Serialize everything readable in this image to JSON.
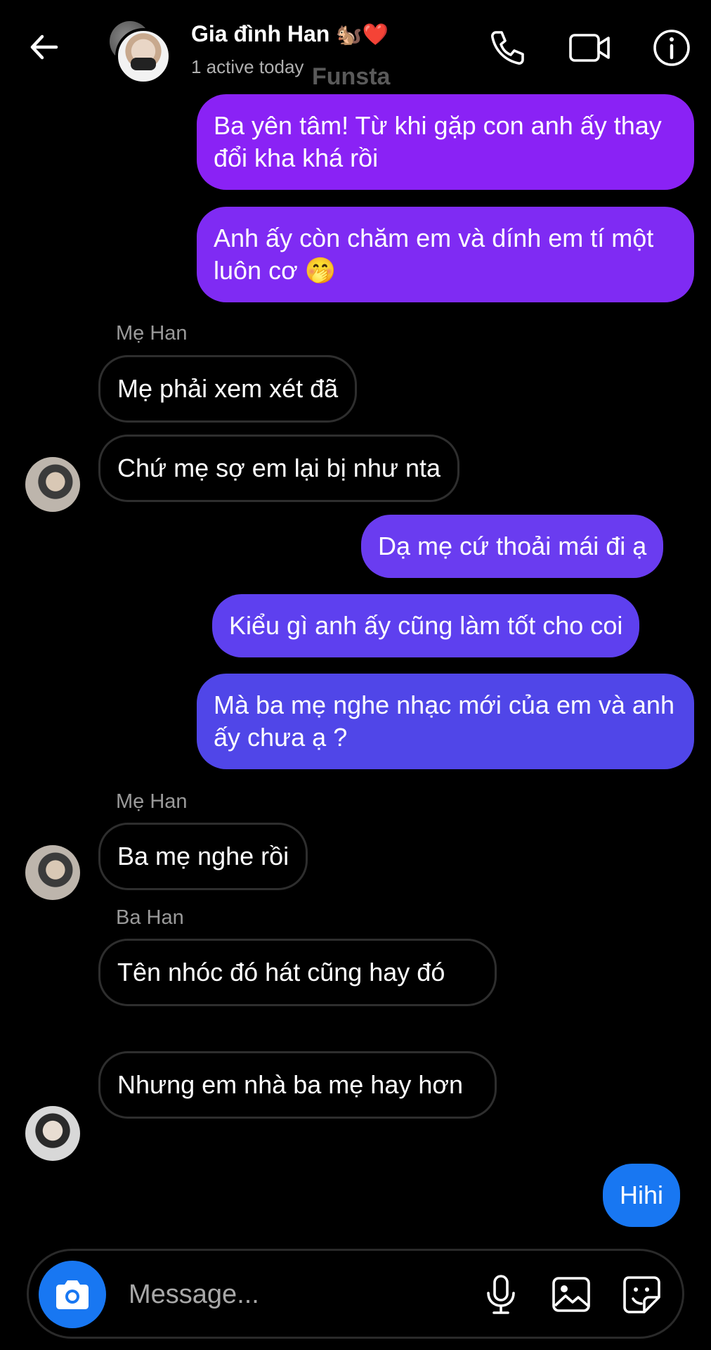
{
  "header": {
    "title": "Gia đình Han",
    "title_emoji": "🐿️❤️",
    "status": "1 active today",
    "watermark": "Funsta"
  },
  "messages": [
    {
      "id": "m1",
      "side": "out",
      "text": "Ba yên tâm! Từ khi gặp con anh ấy thay đổi kha khá rồi"
    },
    {
      "id": "m2",
      "side": "out",
      "text": "Anh ấy còn chăm em và dính em tí một luôn cơ 🤭"
    },
    {
      "id": "s1",
      "type": "sender",
      "name": "Mẹ Han"
    },
    {
      "id": "m3",
      "side": "in",
      "text": "Mẹ phải xem xét đã"
    },
    {
      "id": "m4",
      "side": "in",
      "text": "Chứ mẹ sợ em lại bị như nta"
    },
    {
      "id": "m5",
      "side": "out",
      "text": "Dạ mẹ cứ thoải mái đi ạ"
    },
    {
      "id": "m6",
      "side": "out",
      "text": "Kiểu gì anh ấy cũng làm tốt cho coi"
    },
    {
      "id": "m7",
      "side": "out",
      "text": "Mà ba mẹ nghe nhạc mới của em và anh ấy chưa ạ ?"
    },
    {
      "id": "s2",
      "type": "sender",
      "name": "Mẹ Han"
    },
    {
      "id": "m8",
      "side": "in",
      "text": "Ba mẹ nghe rồi"
    },
    {
      "id": "s3",
      "type": "sender",
      "name": "Ba Han"
    },
    {
      "id": "m9",
      "side": "in",
      "text": "Tên nhóc đó hát cũng hay đó"
    },
    {
      "id": "m10",
      "side": "in",
      "text": "Nhưng em nhà ba mẹ hay hơn"
    },
    {
      "id": "m11",
      "side": "out",
      "text": "Hihi"
    }
  ],
  "composer": {
    "placeholder": "Message..."
  },
  "colors": {
    "bubble_purple": "#8a22f5",
    "bubble_violet": "#6a3cf0",
    "bubble_indigo": "#5046e8",
    "bubble_blue": "#1877f2",
    "incoming_border": "#2e2e2e",
    "camera_button": "#1877f2"
  },
  "icons": {
    "back": "arrow-left-icon",
    "call": "phone-icon",
    "video": "video-camera-icon",
    "info": "info-icon",
    "camera": "camera-icon",
    "mic": "microphone-icon",
    "gallery": "image-icon",
    "sticker": "sticker-icon"
  }
}
